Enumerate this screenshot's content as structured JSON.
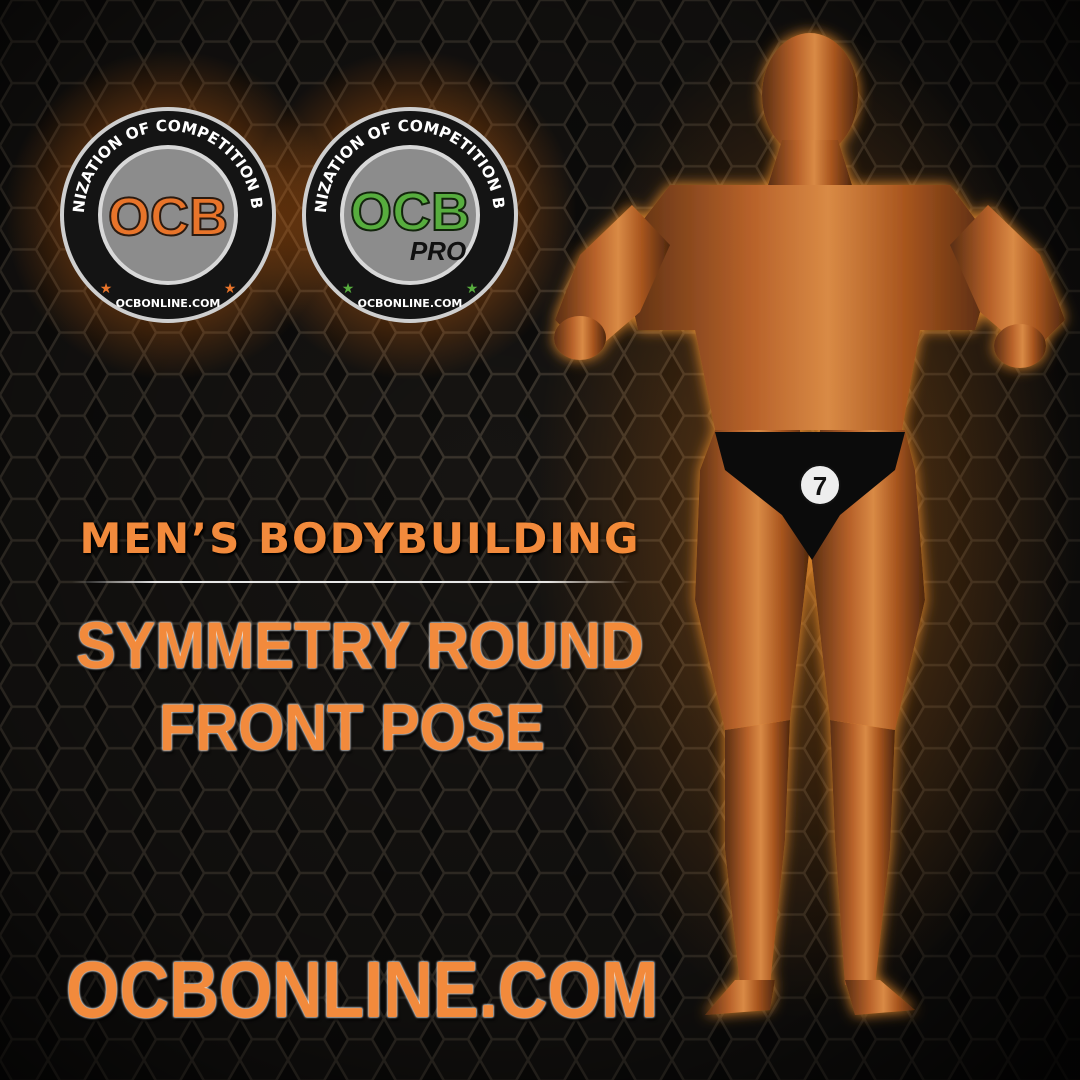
{
  "colors": {
    "background": "#0d0c0b",
    "hex_grid": "#3a342c",
    "glow": "#ff8a1a",
    "title_orange": "#f28a3c",
    "ocb_orange": "#e8742a",
    "ocb_pro_green": "#57ad3e",
    "badge_ring": "#1a1a1a"
  },
  "logos": [
    {
      "ring_text": "ORGANIZATION OF COMPETITION BODIES",
      "wordmark": "OCB",
      "subtext": "",
      "url_text": "OCBONLINE.COM",
      "accent": "#e8742a",
      "star_color": "#e8742a"
    },
    {
      "ring_text": "ORGANIZATION OF COMPETITION BODIES",
      "wordmark": "OCB",
      "subtext": "PRO",
      "url_text": "OCBONLINE.COM",
      "accent": "#57ad3e",
      "star_color": "#57ad3e"
    }
  ],
  "headline": {
    "category": "MEN’S BODYBUILDING",
    "round": "SYMMETRY ROUND",
    "pose": "FRONT POSE"
  },
  "footer": {
    "website": "OCBONLINE.COM"
  },
  "athlete": {
    "competitor_number": "7"
  }
}
